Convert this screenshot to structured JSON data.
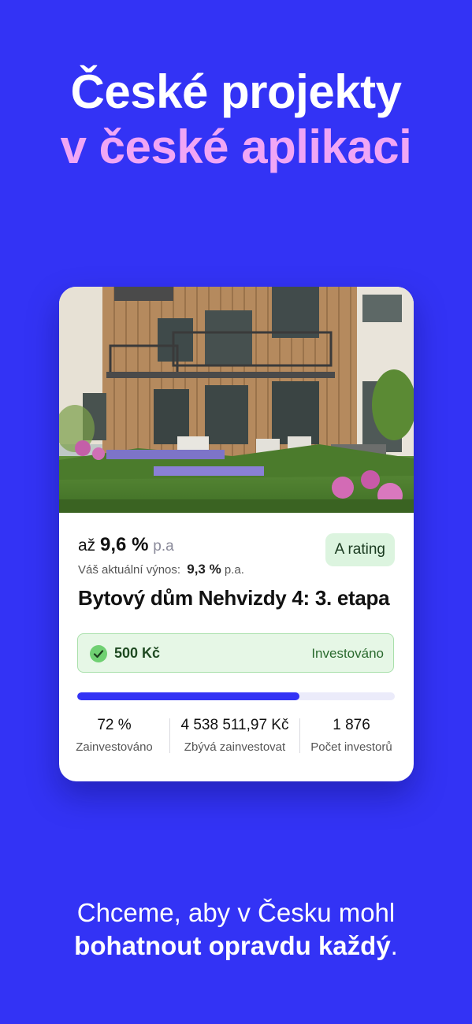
{
  "headline": {
    "line1": "České projekty",
    "line2": "v české aplikaci"
  },
  "card": {
    "yield": {
      "prefix": "až",
      "value": "9,6 %",
      "unit": "p.a"
    },
    "current": {
      "label": "Váš aktuální výnos:",
      "value": "9,3 %",
      "unit": "p.a."
    },
    "rating": "A rating",
    "title": "Bytový dům Nehvizdy 4: 3. etapa",
    "invested": {
      "amount": "500 Kč",
      "status": "Investováno",
      "icon": "check-icon"
    },
    "progress_fraction": 0.7,
    "stats": [
      {
        "value": "72 %",
        "label": "Zainvestováno"
      },
      {
        "value": "4 538 511,97 Kč",
        "label": "Zbývá zainvestovat"
      },
      {
        "value": "1 876",
        "label": "Počet investorů"
      }
    ]
  },
  "tagline": {
    "line1": "Chceme, aby v Česku mohl",
    "line2_bold": "bohatnout opravdu každý",
    "line2_end": "."
  },
  "colors": {
    "background": "#3333f5",
    "accent_pink": "#f0a6f5",
    "rating_bg": "#dcf4df",
    "success": "#6fd072"
  }
}
